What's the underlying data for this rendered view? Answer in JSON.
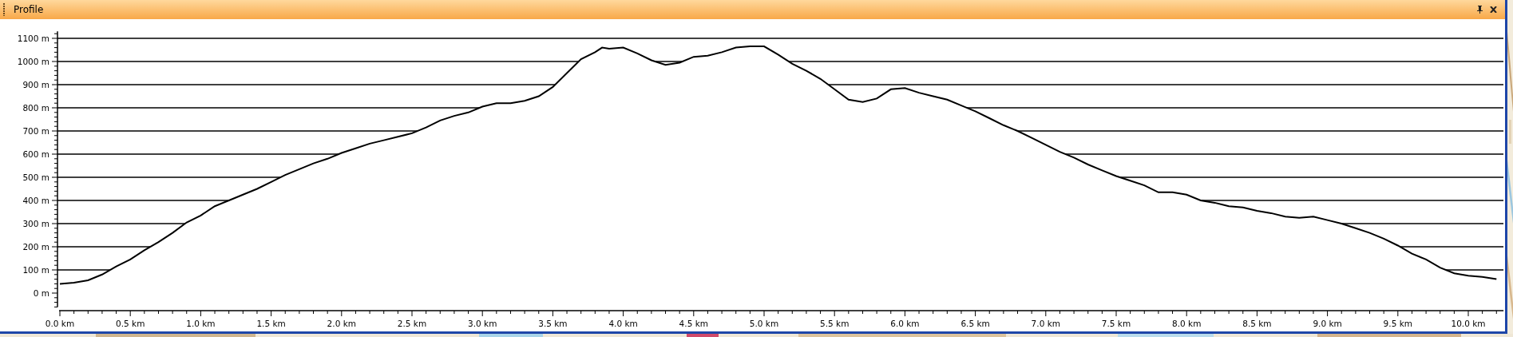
{
  "panel": {
    "title": "Profile"
  },
  "chart_data": {
    "type": "line",
    "grid": true,
    "xlim": [
      0,
      10.25
    ],
    "ylim": [
      -60,
      1130
    ],
    "xticks": [
      {
        "value": 0,
        "label": "0.0 km"
      },
      {
        "value": 0.5,
        "label": "0.5 km"
      },
      {
        "value": 1,
        "label": "1.0 km"
      },
      {
        "value": 1.5,
        "label": "1.5 km"
      },
      {
        "value": 2,
        "label": "2.0 km"
      },
      {
        "value": 2.5,
        "label": "2.5 km"
      },
      {
        "value": 3,
        "label": "3.0 km"
      },
      {
        "value": 3.5,
        "label": "3.5 km"
      },
      {
        "value": 4,
        "label": "4.0 km"
      },
      {
        "value": 4.5,
        "label": "4.5 km"
      },
      {
        "value": 5,
        "label": "5.0 km"
      },
      {
        "value": 5.5,
        "label": "5.5 km"
      },
      {
        "value": 6,
        "label": "6.0 km"
      },
      {
        "value": 6.5,
        "label": "6.5 km"
      },
      {
        "value": 7,
        "label": "7.0 km"
      },
      {
        "value": 7.5,
        "label": "7.5 km"
      },
      {
        "value": 8,
        "label": "8.0 km"
      },
      {
        "value": 8.5,
        "label": "8.5 km"
      },
      {
        "value": 9,
        "label": "9.0 km"
      },
      {
        "value": 9.5,
        "label": "9.5 km"
      },
      {
        "value": 10,
        "label": "10.0 km"
      }
    ],
    "yticks": [
      {
        "value": 0,
        "label": "0 m"
      },
      {
        "value": 100,
        "label": "100 m"
      },
      {
        "value": 200,
        "label": "200 m"
      },
      {
        "value": 300,
        "label": "300 m"
      },
      {
        "value": 400,
        "label": "400 m"
      },
      {
        "value": 500,
        "label": "500 m"
      },
      {
        "value": 600,
        "label": "600 m"
      },
      {
        "value": 700,
        "label": "700 m"
      },
      {
        "value": 800,
        "label": "800 m"
      },
      {
        "value": 900,
        "label": "900 m"
      },
      {
        "value": 1000,
        "label": "1000 m"
      },
      {
        "value": 1100,
        "label": "1100 m"
      }
    ],
    "x": [
      0,
      0.1,
      0.2,
      0.3,
      0.4,
      0.5,
      0.6,
      0.7,
      0.8,
      0.9,
      1,
      1.1,
      1.2,
      1.3,
      1.4,
      1.5,
      1.6,
      1.7,
      1.8,
      1.9,
      2,
      2.1,
      2.2,
      2.3,
      2.4,
      2.5,
      2.6,
      2.7,
      2.8,
      2.9,
      3,
      3.1,
      3.2,
      3.3,
      3.4,
      3.5,
      3.6,
      3.7,
      3.8,
      3.85,
      3.9,
      4,
      4.1,
      4.2,
      4.3,
      4.4,
      4.5,
      4.6,
      4.7,
      4.8,
      4.9,
      5,
      5.1,
      5.2,
      5.3,
      5.4,
      5.5,
      5.6,
      5.7,
      5.8,
      5.9,
      6,
      6.1,
      6.2,
      6.3,
      6.4,
      6.5,
      6.6,
      6.7,
      6.8,
      6.9,
      7,
      7.1,
      7.2,
      7.3,
      7.4,
      7.5,
      7.6,
      7.7,
      7.8,
      7.9,
      8,
      8.1,
      8.2,
      8.3,
      8.4,
      8.5,
      8.6,
      8.7,
      8.8,
      8.9,
      9,
      9.1,
      9.2,
      9.3,
      9.4,
      9.5,
      9.6,
      9.7,
      9.8,
      9.9,
      10,
      10.1,
      10.2
    ],
    "series": [
      {
        "color": "#000000",
        "values": [
          40,
          45,
          55,
          80,
          115,
          145,
          185,
          220,
          260,
          305,
          335,
          375,
          400,
          425,
          450,
          480,
          510,
          535,
          560,
          580,
          605,
          625,
          645,
          660,
          675,
          690,
          715,
          745,
          765,
          780,
          805,
          820,
          820,
          830,
          850,
          890,
          950,
          1010,
          1040,
          1060,
          1055,
          1060,
          1035,
          1005,
          985,
          995,
          1020,
          1025,
          1040,
          1060,
          1065,
          1065,
          1030,
          990,
          960,
          925,
          880,
          835,
          825,
          840,
          880,
          885,
          865,
          850,
          835,
          810,
          785,
          755,
          725,
          700,
          670,
          640,
          610,
          585,
          555,
          530,
          505,
          485,
          465,
          435,
          435,
          425,
          400,
          390,
          375,
          370,
          355,
          345,
          330,
          325,
          330,
          315,
          300,
          280,
          260,
          235,
          205,
          170,
          145,
          110,
          85,
          75,
          70,
          60
        ]
      }
    ]
  }
}
